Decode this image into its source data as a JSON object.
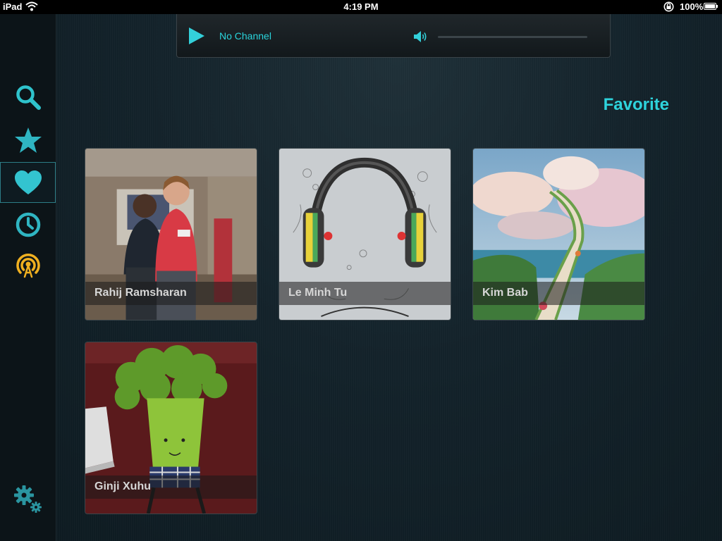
{
  "status_bar": {
    "device": "iPad",
    "time": "4:19 PM",
    "battery": "100%"
  },
  "sidebar": {
    "items": [
      {
        "icon": "search-icon",
        "label": "Search",
        "active": false
      },
      {
        "icon": "star-icon",
        "label": "Featured",
        "active": false
      },
      {
        "icon": "heart-icon",
        "label": "Favorite",
        "active": true
      },
      {
        "icon": "clock-icon",
        "label": "Recent",
        "active": false
      },
      {
        "icon": "broadcast-icon",
        "label": "Broadcast",
        "active": false
      }
    ],
    "settings_icon": "gear-icon"
  },
  "player": {
    "channel": "No Channel",
    "play_icon": "play-icon",
    "volume_icon": "speaker-icon"
  },
  "page": {
    "title": "Favorite"
  },
  "favorites": [
    {
      "name": "Rahij Ramsharan"
    },
    {
      "name": "Le Minh Tu"
    },
    {
      "name": "Kim Bab"
    },
    {
      "name": "Ginji Xuhu"
    }
  ],
  "colors": {
    "accent": "#2ed3dc",
    "broadcast": "#f0b020",
    "background": "#13222a"
  }
}
